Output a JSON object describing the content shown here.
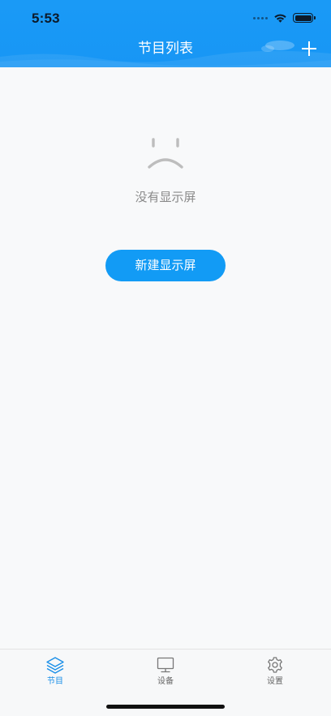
{
  "status_bar": {
    "time": "5:53"
  },
  "header": {
    "title": "节目列表"
  },
  "empty_state": {
    "message": "没有显示屏",
    "button_label": "新建显示屏"
  },
  "tab_bar": {
    "tabs": [
      {
        "label": "节目",
        "icon": "layers-icon",
        "active": true
      },
      {
        "label": "设备",
        "icon": "monitor-icon",
        "active": false
      },
      {
        "label": "设置",
        "icon": "gear-icon",
        "active": false
      }
    ]
  },
  "colors": {
    "header_blue": "#1796f5",
    "button_blue": "#129bf5",
    "active_tab": "#1a8fe8",
    "background": "#f8f9fa"
  }
}
